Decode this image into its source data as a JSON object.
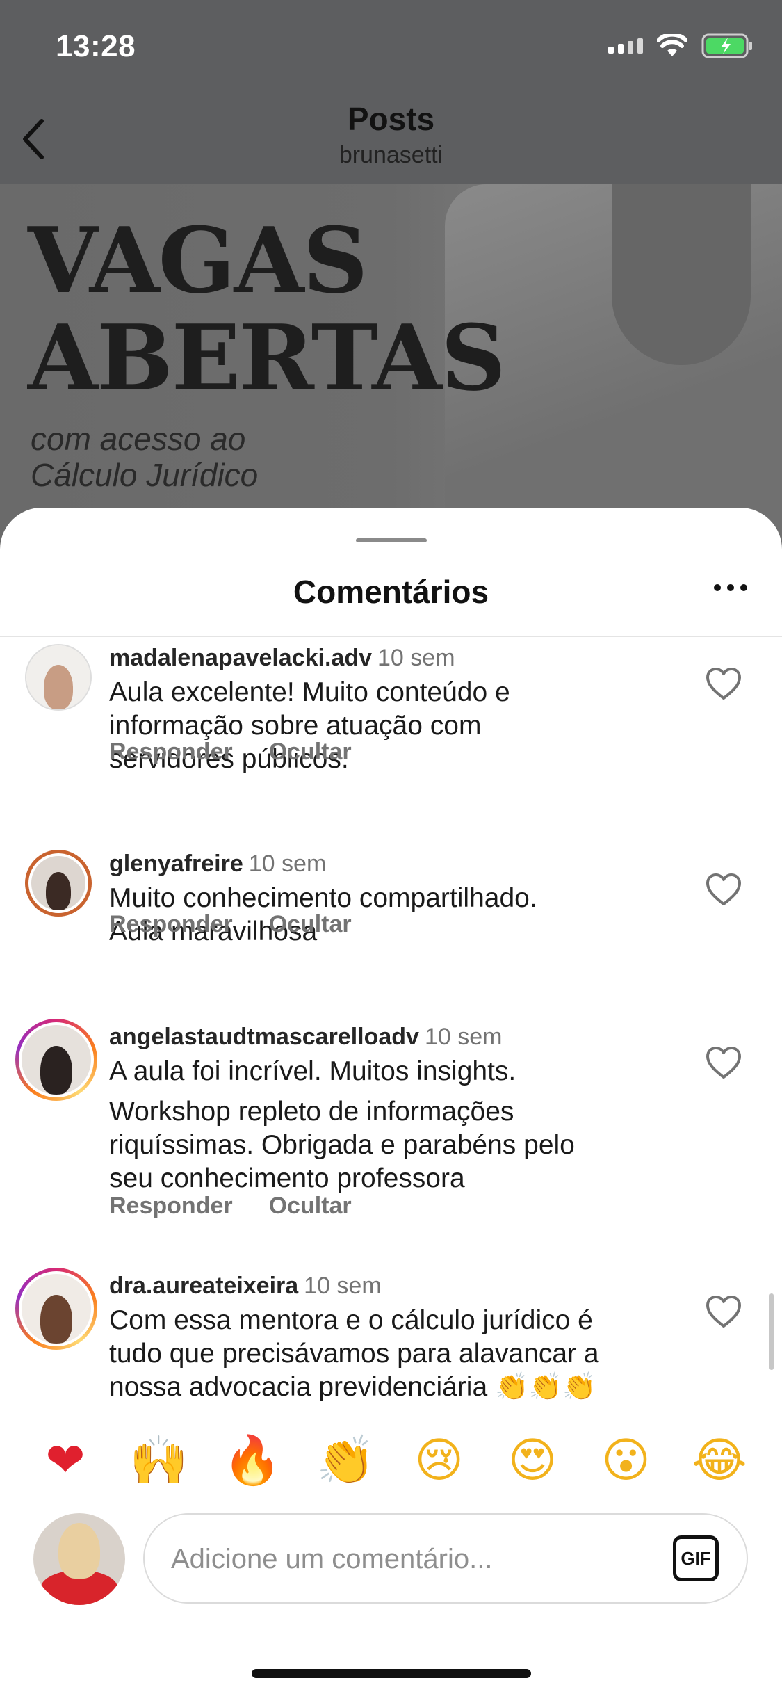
{
  "status_bar": {
    "time": "13:28"
  },
  "header": {
    "title": "Posts",
    "username": "brunasetti"
  },
  "post": {
    "headline_line1": "VAGAS",
    "headline_line2": "ABERTAS",
    "subheadline_line1": "com acesso ao",
    "subheadline_line2": "Cálculo Jurídico"
  },
  "sheet": {
    "title": "Comentários"
  },
  "comments": [
    {
      "username": "madalenapavelacki.adv",
      "time": "10 sem",
      "lines": [
        "Aula excelente! Muito conteúdo e",
        "informação sobre atuação com",
        "servidores públicos."
      ],
      "reply_label": "Responder",
      "hide_label": "Ocultar"
    },
    {
      "username": "glenyafreire",
      "time": "10 sem",
      "lines": [
        "Muito conhecimento compartilhado.",
        "Aula maravilhosa"
      ],
      "reply_label": "Responder",
      "hide_label": "Ocultar"
    },
    {
      "username": "angelastaudtmascarelloadv",
      "time": "10 sem",
      "lines": [
        "A aula foi incrível. Muitos insights.",
        "Workshop repleto de informações",
        "riquíssimas. Obrigada e parabéns pelo",
        "seu conhecimento professora"
      ],
      "reply_label": "Responder",
      "hide_label": "Ocultar"
    },
    {
      "username": "dra.aureateixeira",
      "time": "10 sem",
      "lines": [
        "Com essa mentora e o cálculo jurídico é",
        "tudo que precisávamos para alavancar a",
        "nossa advocacia previdenciária 👏👏👏"
      ]
    }
  ],
  "reactions": [
    "❤",
    "🙌",
    "🔥",
    "👏",
    "😢",
    "😍",
    "😮",
    "😂"
  ],
  "composer": {
    "placeholder": "Adicione um comentário...",
    "gif_label": "GIF"
  },
  "colors": {
    "backdrop": "#5d5e60",
    "text_primary": "#262626",
    "text_secondary": "#737373",
    "like_red": "#e0202e"
  }
}
